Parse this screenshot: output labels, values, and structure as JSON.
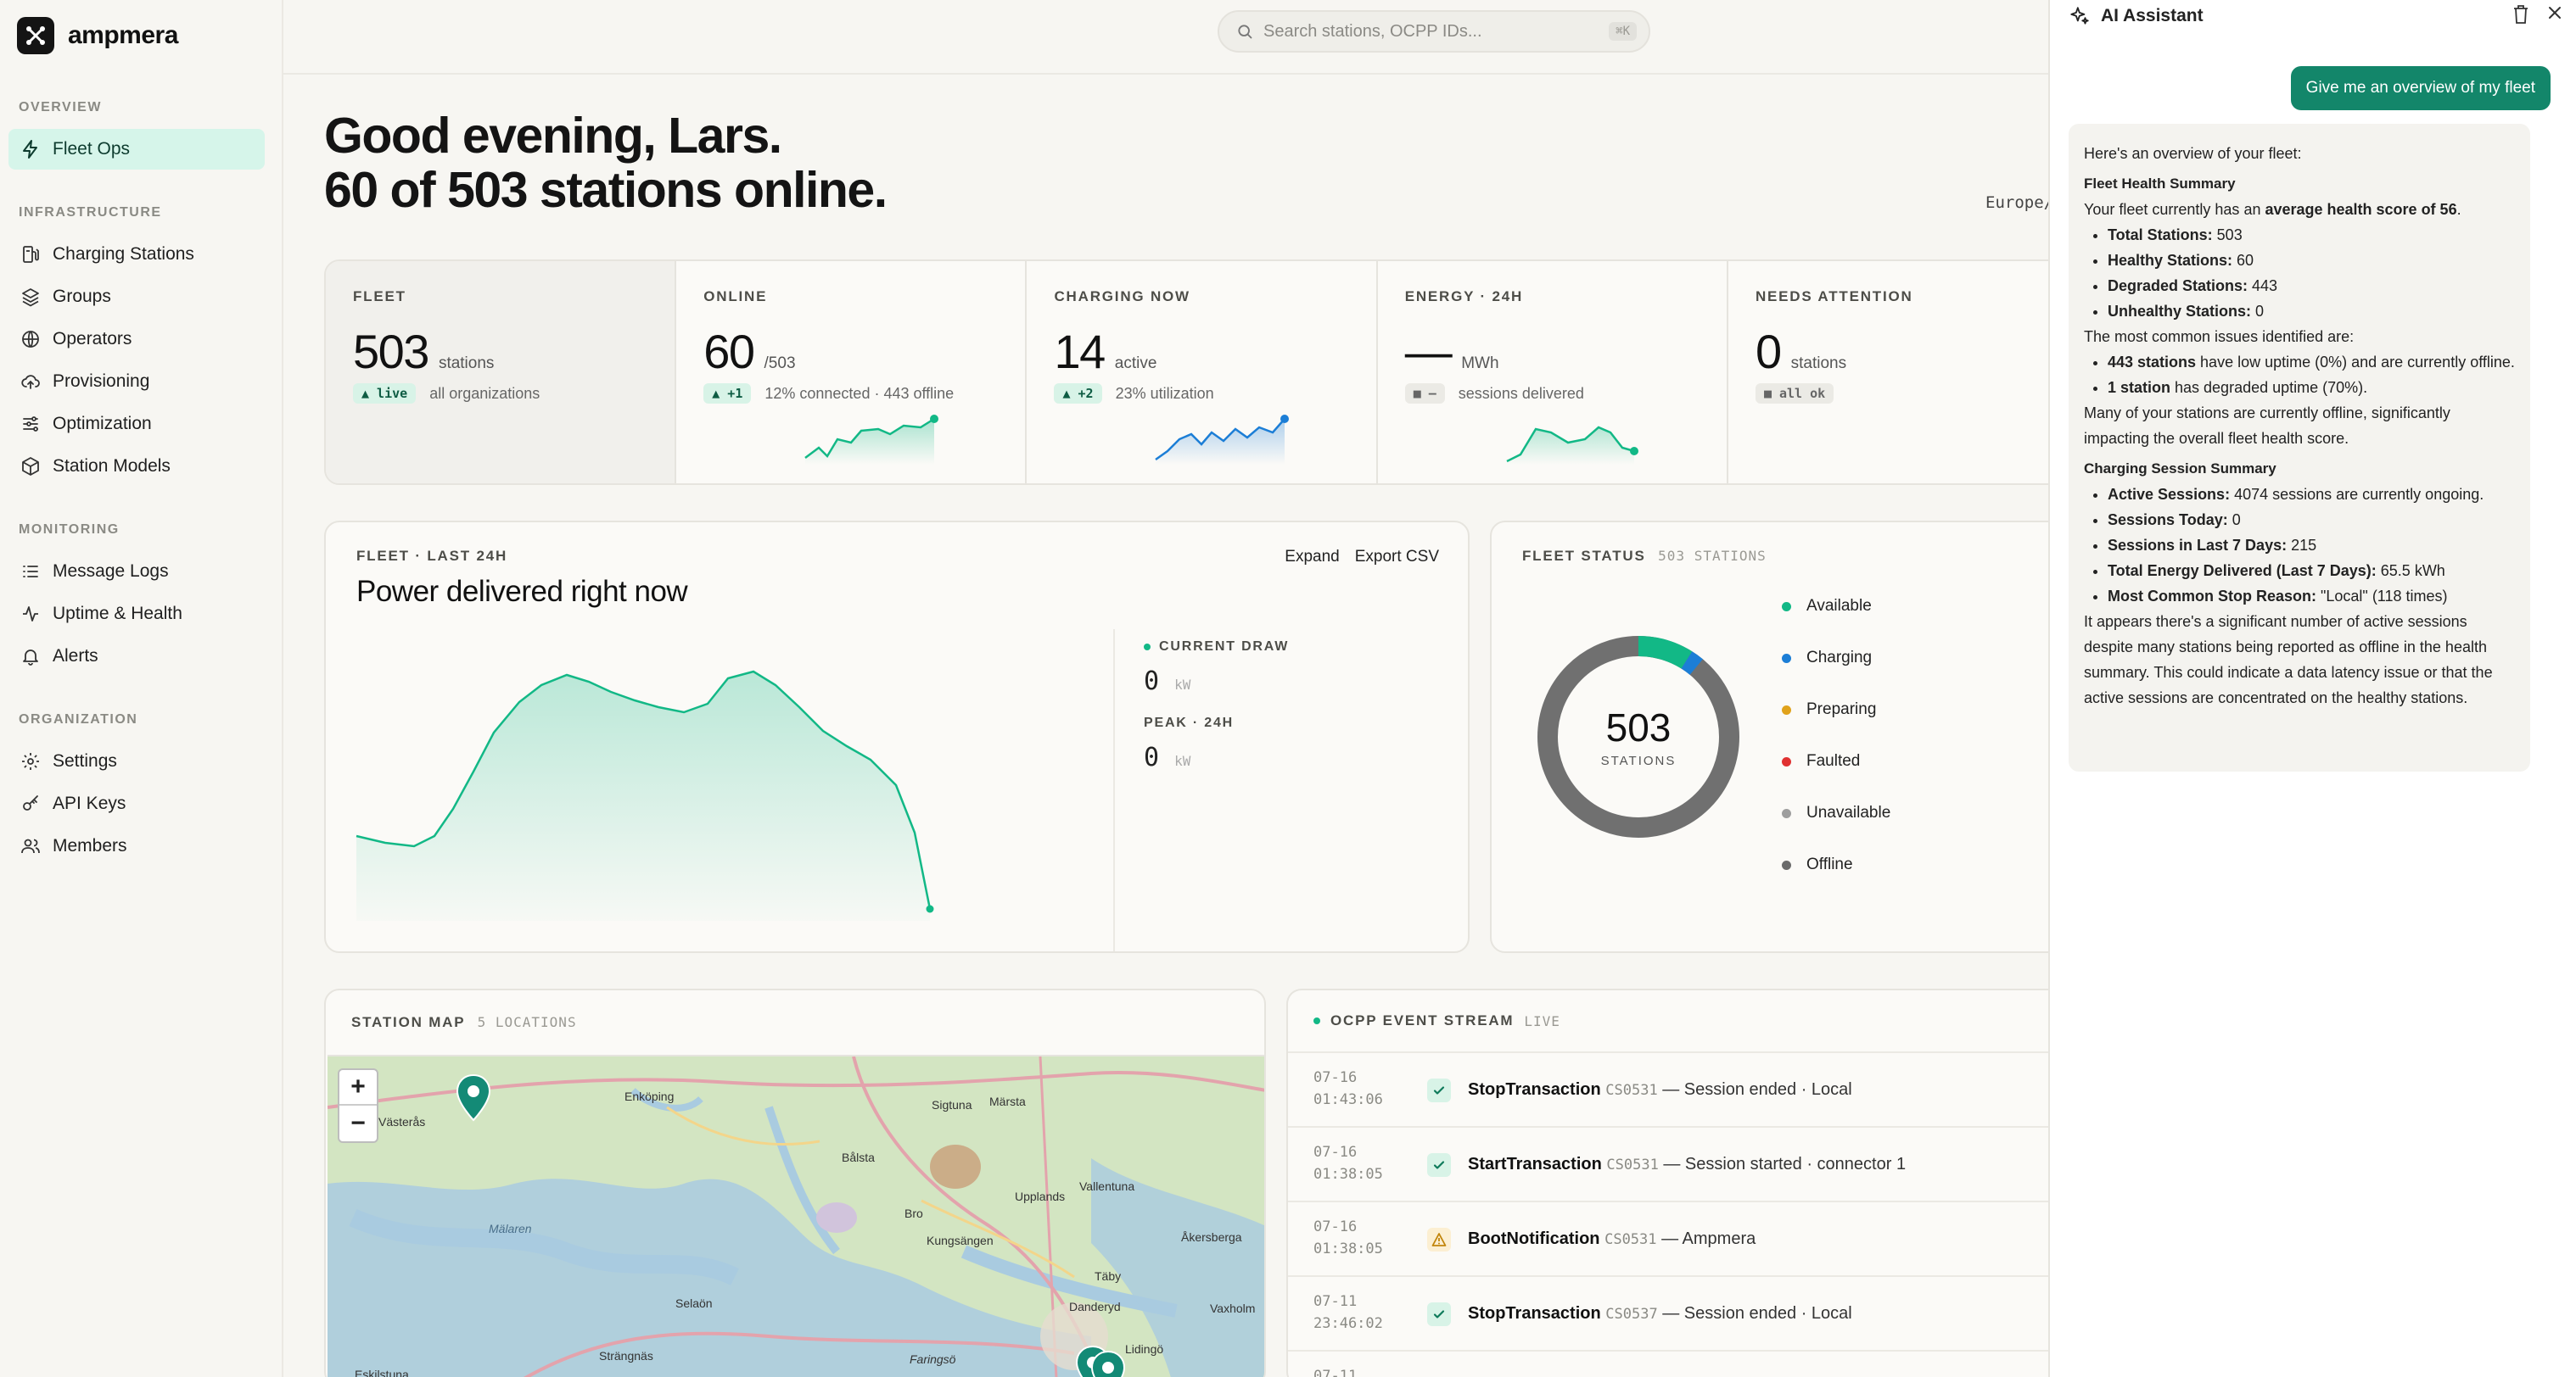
{
  "brand": {
    "name": "ampmera"
  },
  "sidebar": {
    "sections": [
      {
        "label": "OVERVIEW"
      },
      {
        "label": "INFRASTRUCTURE"
      },
      {
        "label": "MONITORING"
      },
      {
        "label": "ORGANIZATION"
      }
    ],
    "items": [
      {
        "label": "Fleet Ops",
        "icon": "bolt-icon"
      },
      {
        "label": "Charging Stations",
        "icon": "charging-station-icon"
      },
      {
        "label": "Groups",
        "icon": "layers-icon"
      },
      {
        "label": "Operators",
        "icon": "globe-icon"
      },
      {
        "label": "Provisioning",
        "icon": "cloud-upload-icon"
      },
      {
        "label": "Optimization",
        "icon": "sliders-icon"
      },
      {
        "label": "Station Models",
        "icon": "box-icon"
      },
      {
        "label": "Message Logs",
        "icon": "list-icon"
      },
      {
        "label": "Uptime & Health",
        "icon": "activity-icon"
      },
      {
        "label": "Alerts",
        "icon": "bell-icon"
      },
      {
        "label": "Settings",
        "icon": "gear-icon"
      },
      {
        "label": "API Keys",
        "icon": "key-icon"
      },
      {
        "label": "Members",
        "icon": "users-icon"
      }
    ]
  },
  "search": {
    "placeholder": "Search stations, OCPP IDs...",
    "shortcut": "⌘K"
  },
  "header": {
    "greeting": "Good evening, Lars.",
    "summary": "60 of 503 stations online.",
    "timezone": "Europe/"
  },
  "kpis": [
    {
      "label": "FLEET",
      "value": "503",
      "unit": "stations",
      "badge": "▲ live",
      "sub": "all organizations"
    },
    {
      "label": "ONLINE",
      "value": "60",
      "unit": "/503",
      "badge": "▲ +1",
      "sub": "12% connected · 443 offline"
    },
    {
      "label": "CHARGING NOW",
      "value": "14",
      "unit": "active",
      "badge": "▲ +2",
      "sub": "23% utilization"
    },
    {
      "label": "ENERGY · 24H",
      "value": "—",
      "unit": "MWh",
      "badge": "■ –",
      "sub": "sessions delivered"
    },
    {
      "label": "NEEDS ATTENTION",
      "value": "0",
      "unit": "stations",
      "badge": "■ all ok",
      "sub": ""
    }
  ],
  "power": {
    "eyebrow": "FLEET · LAST 24H",
    "title": "Power delivered right now",
    "expand": "Expand",
    "export": "Export CSV",
    "current_label": "CURRENT DRAW",
    "current_value": "0",
    "current_unit": "kW",
    "peak_label": "PEAK · 24H",
    "peak_value": "0",
    "peak_unit": "kW"
  },
  "fleet_status": {
    "eyebrow": "FLEET STATUS",
    "count_label": "503 STATIONS",
    "center_value": "503",
    "center_label": "STATIONS",
    "legend": [
      {
        "label": "Available",
        "color": "#12b886"
      },
      {
        "label": "Charging",
        "color": "#1c7ed6"
      },
      {
        "label": "Preparing",
        "color": "#e0a21b"
      },
      {
        "label": "Faulted",
        "color": "#e03131"
      },
      {
        "label": "Unavailable",
        "color": "#9e9e9e"
      },
      {
        "label": "Offline",
        "color": "#6b6b6b"
      }
    ]
  },
  "map": {
    "eyebrow": "STATION MAP",
    "count_label": "5 LOCATIONS",
    "zoom_in": "+",
    "zoom_out": "−",
    "places": [
      "Västerås",
      "Enköping",
      "Sigtuna",
      "Märsta",
      "Bålsta",
      "Upplands",
      "Vallentuna",
      "Kungsängen",
      "Bro",
      "Åkersberga",
      "Mälaren",
      "Täby",
      "Danderyd",
      "Vaxholm",
      "Strängnäs",
      "Eskilstuna",
      "Selaön",
      "Faringsö",
      "Lidingö"
    ]
  },
  "events": {
    "eyebrow": "OCPP EVENT STREAM",
    "live_label": "LIVE",
    "rows": [
      {
        "date": "07-16",
        "time": "01:43:06",
        "type": "StopTransaction",
        "station": "CS0531",
        "desc": "— Session ended · Local",
        "status": "ok"
      },
      {
        "date": "07-16",
        "time": "01:38:05",
        "type": "StartTransaction",
        "station": "CS0531",
        "desc": "— Session started · connector 1",
        "status": "ok"
      },
      {
        "date": "07-16",
        "time": "01:38:05",
        "type": "BootNotification",
        "station": "CS0531",
        "desc": "— Ampmera",
        "status": "warn"
      },
      {
        "date": "07-11",
        "time": "23:46:02",
        "type": "StopTransaction",
        "station": "CS0537",
        "desc": "— Session ended · Local",
        "status": "ok"
      },
      {
        "date": "07-11",
        "time": "",
        "type": "",
        "station": "",
        "desc": "",
        "status": "ok"
      }
    ]
  },
  "assistant": {
    "title": "AI Assistant",
    "user_message": "Give me an overview of my fleet",
    "intro": "Here's an overview of your fleet:",
    "health_heading": "Fleet Health Summary",
    "health_pre": "Your fleet currently has an ",
    "health_bold": "average health score of 56",
    "health_post": ".",
    "health_items": [
      {
        "k": "Total Stations:",
        "v": " 503"
      },
      {
        "k": "Healthy Stations:",
        "v": " 60"
      },
      {
        "k": "Degraded Stations:",
        "v": " 443"
      },
      {
        "k": "Unhealthy Stations:",
        "v": " 0"
      }
    ],
    "issues_intro": "The most common issues identified are:",
    "issues": [
      {
        "k": "443 stations",
        "v": " have low uptime (0%) and are currently offline."
      },
      {
        "k": "1 station",
        "v": " has degraded uptime (70%)."
      }
    ],
    "issues_note": "Many of your stations are currently offline, significantly impacting the overall fleet health score.",
    "session_heading": "Charging Session Summary",
    "session_items": [
      {
        "k": "Active Sessions:",
        "v": " 4074 sessions are currently ongoing."
      },
      {
        "k": "Sessions Today:",
        "v": " 0"
      },
      {
        "k": "Sessions in Last 7 Days:",
        "v": " 215"
      },
      {
        "k": "Total Energy Delivered (Last 7 Days):",
        "v": " 65.5 kWh"
      },
      {
        "k": "Most Common Stop Reason:",
        "v": " \"Local\" (118 times)"
      }
    ],
    "closing": "It appears there's a significant number of active sessions despite many stations being reported as offline in the health summary. This could indicate a data latency issue or that the active sessions are concentrated on the healthy stations."
  }
}
